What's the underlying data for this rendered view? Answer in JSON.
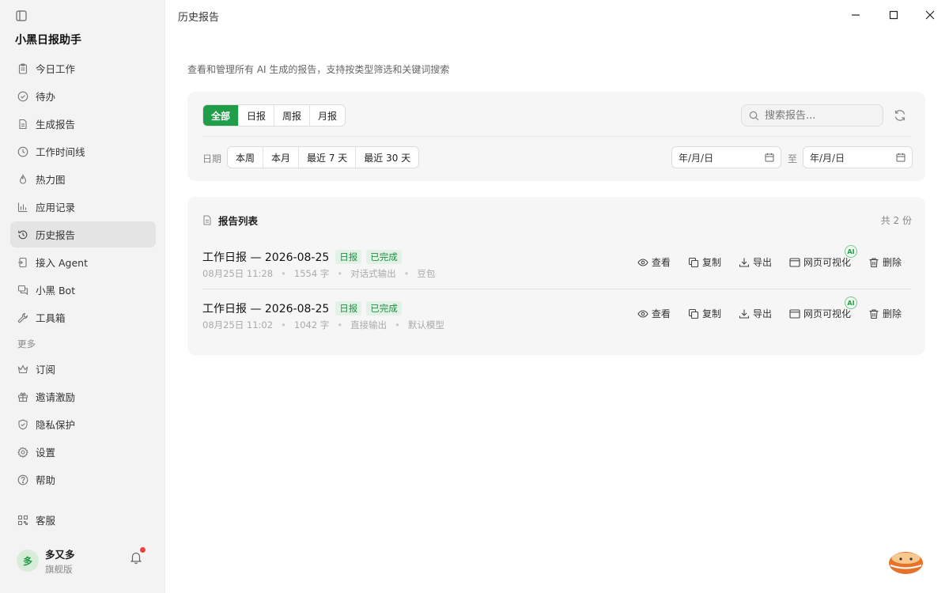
{
  "sidebar": {
    "app_title": "小黑日报助手",
    "items": [
      {
        "label": "今日工作",
        "icon": "clipboard-icon"
      },
      {
        "label": "待办",
        "icon": "check-circle-icon"
      },
      {
        "label": "生成报告",
        "icon": "document-icon"
      },
      {
        "label": "工作时间线",
        "icon": "clock-icon"
      },
      {
        "label": "热力图",
        "icon": "flame-icon"
      },
      {
        "label": "应用记录",
        "icon": "bar-chart-icon"
      },
      {
        "label": "历史报告",
        "icon": "history-icon",
        "active": true
      },
      {
        "label": "接入 Agent",
        "icon": "plug-icon"
      },
      {
        "label": "小黑 Bot",
        "icon": "chat-icon"
      },
      {
        "label": "工具箱",
        "icon": "wrench-icon"
      }
    ],
    "section_more": "更多",
    "more_items": [
      {
        "label": "订阅",
        "icon": "crown-icon"
      },
      {
        "label": "邀请激励",
        "icon": "gift-icon"
      },
      {
        "label": "隐私保护",
        "icon": "shield-icon"
      },
      {
        "label": "设置",
        "icon": "gear-icon"
      },
      {
        "label": "帮助",
        "icon": "help-icon"
      }
    ],
    "service": "客服",
    "user": {
      "avatar": "多",
      "name": "多又多",
      "plan": "旗舰版"
    }
  },
  "window": {
    "title": "历史报告"
  },
  "main": {
    "subtitle": "查看和管理所有 AI 生成的报告，支持按类型筛选和关键词搜索",
    "type_filters": [
      "全部",
      "日报",
      "周报",
      "月报"
    ],
    "date_label": "日期",
    "range_filters": [
      "本周",
      "本月",
      "最近 7 天",
      "最近 30 天"
    ],
    "search_placeholder": "搜索报告...",
    "date_from": "年/月/日",
    "date_to_label": "至",
    "date_to": "年/月/日",
    "list_title": "报告列表",
    "list_count": "共 2 份",
    "actions": {
      "view": "查看",
      "copy": "复制",
      "export": "导出",
      "visualize": "网页可视化",
      "ai": "AI",
      "delete": "删除"
    },
    "reports": [
      {
        "title": "工作日报 — 2026-08-25",
        "type": "日报",
        "status": "已完成",
        "time": "08月25日 11:28",
        "words": "1554 字",
        "mode": "对话式输出",
        "model": "豆包"
      },
      {
        "title": "工作日报 — 2026-08-25",
        "type": "日报",
        "status": "已完成",
        "time": "08月25日 11:02",
        "words": "1042 字",
        "mode": "直接输出",
        "model": "默认模型"
      }
    ]
  },
  "colors": {
    "accent": "#1f9d48",
    "sidebar_bg": "#f3f3f3",
    "card_bg": "#f6f6f6"
  }
}
